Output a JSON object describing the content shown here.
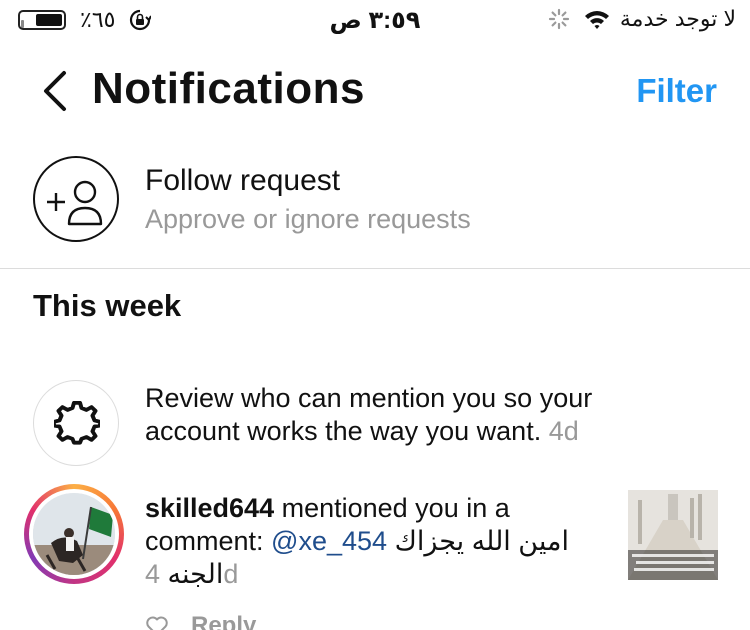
{
  "status_bar": {
    "carrier": "لا توجد خدمة",
    "time": "٣:٥٩ ص",
    "battery_percent": "٪٦٥",
    "battery_level": 0.65
  },
  "nav": {
    "title": "Notifications",
    "filter_label": "Filter"
  },
  "follow_request": {
    "title": "Follow request",
    "subtitle": "Approve or ignore requests"
  },
  "section": {
    "heading": "This week"
  },
  "notifications": [
    {
      "line1": "Review who can mention you so your",
      "line2": "account works the way you want.",
      "time": "4d"
    },
    {
      "username": "skilled644",
      "action": " mentioned you in a",
      "comment_prefix": "comment: ",
      "mention": "@xe_454",
      "comment_text": "امين الله يجزاك",
      "comment_text2": "الجنه",
      "time": "4d",
      "reply_label": "Reply"
    }
  ],
  "colors": {
    "accent": "#2196f3",
    "muted": "#999999",
    "mention_link": "#1f4d8c"
  },
  "icons": {
    "back": "chevron-left-icon",
    "follow": "add-person-icon",
    "settings": "gear-icon",
    "like": "heart-icon",
    "lock": "orientation-lock-icon",
    "wifi": "wifi-icon",
    "spinner": "activity-spinner-icon"
  }
}
